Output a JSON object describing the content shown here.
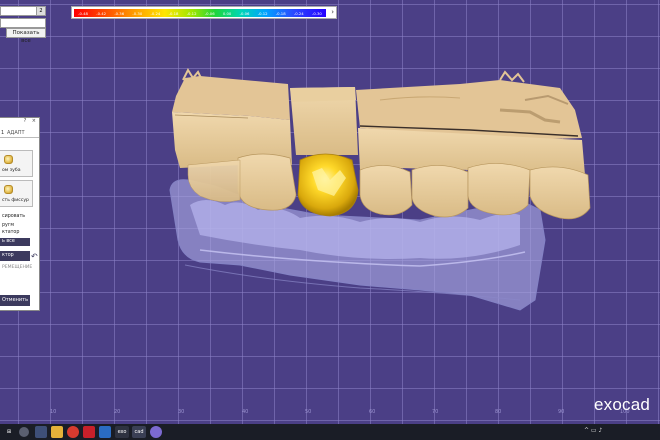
{
  "top_left": {
    "field1_value": "",
    "field1_number": "2",
    "field2_value": "",
    "show_all_label": "Показать все"
  },
  "color_scale": {
    "ticks": [
      "-0.48",
      "-0.42",
      "-0.36",
      "-0.30",
      "-0.24",
      "-0.18",
      "-0.12",
      "-0.06",
      "0.00",
      "-0.06",
      "-0.12",
      "-0.18",
      "-0.24",
      "-0.30"
    ],
    "arrow": "›"
  },
  "side_panel": {
    "header_icons": "? ×",
    "tab_1": "1",
    "tab_2": "АДАПТ",
    "btn_tooth_label": "ом зуба",
    "btn_fissure_label": "сть фиссур",
    "opt_1": "сировать",
    "opt_2": "ругм",
    "opt_3": "ктатор",
    "all_button": "ь все",
    "motor_button": "ктор",
    "moving_label": "РЕМЕЩЕНИЕ",
    "cancel_button": "Отменить"
  },
  "ruler": {
    "labels": [
      "10",
      "20",
      "30",
      "40",
      "50",
      "60",
      "70",
      "80",
      "90",
      "100"
    ]
  },
  "brand": {
    "logo": "exocad"
  },
  "taskbar": {
    "apps": [
      {
        "icon": "windows-icon",
        "label": ""
      },
      {
        "icon": "search-icon",
        "label": ""
      },
      {
        "icon": "task-view-icon",
        "label": ""
      },
      {
        "icon": "folder-icon",
        "label": ""
      },
      {
        "icon": "chrome-icon",
        "label": ""
      },
      {
        "icon": "opera-icon",
        "label": ""
      },
      {
        "icon": "app-icon",
        "label": ""
      },
      {
        "icon": "exocad-icon",
        "label": "exo"
      },
      {
        "icon": "cad-icon",
        "label": "cad"
      },
      {
        "icon": "viewer-icon",
        "label": ""
      }
    ],
    "tray": "^ ▭ ♪",
    "time": "",
    "date": ""
  },
  "colors": {
    "background": "#4b3f86",
    "grid": "#8c82c8",
    "tooth": "#e5c99a",
    "crown": "#f2c91a",
    "gingiva": "#9a98d8",
    "panel_button": "#3c3a5e"
  }
}
